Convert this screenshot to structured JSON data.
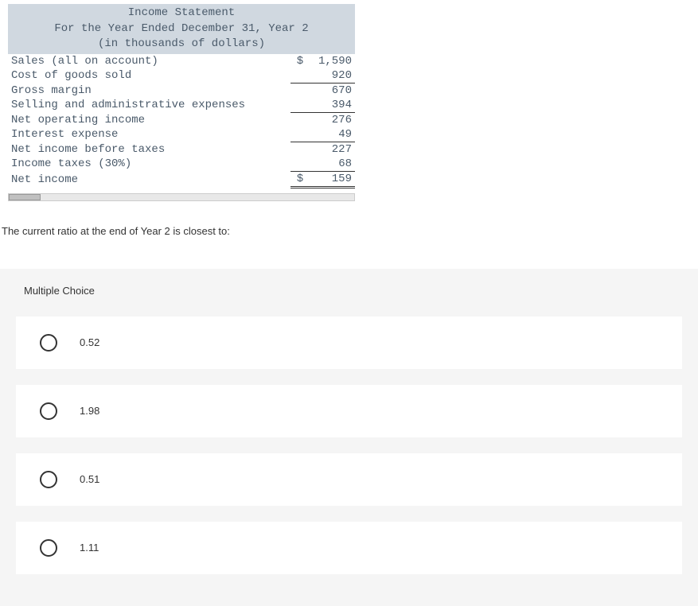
{
  "statement": {
    "title": "Income Statement",
    "subtitle": "For the Year Ended December 31, Year 2",
    "units": "(in thousands of dollars)",
    "rows": [
      {
        "label": "Sales (all on account)",
        "dollar": "$",
        "value": "1,590",
        "underline": ""
      },
      {
        "label": "Cost of goods sold",
        "dollar": "",
        "value": "920",
        "underline": "single"
      },
      {
        "label": "Gross margin",
        "dollar": "",
        "value": "670",
        "underline": ""
      },
      {
        "label": "Selling and administrative expenses",
        "dollar": "",
        "value": "394",
        "underline": "single"
      },
      {
        "label": "Net operating income",
        "dollar": "",
        "value": "276",
        "underline": ""
      },
      {
        "label": "Interest expense",
        "dollar": "",
        "value": "49",
        "underline": "single"
      },
      {
        "label": "Net income before taxes",
        "dollar": "",
        "value": "227",
        "underline": ""
      },
      {
        "label": "Income taxes (30%)",
        "dollar": "",
        "value": "68",
        "underline": "single"
      },
      {
        "label": "Net income",
        "dollar": "$",
        "value": "159",
        "underline": "double"
      }
    ]
  },
  "question": {
    "text": "The current ratio at the end of Year 2 is closest to:"
  },
  "mc": {
    "header": "Multiple Choice",
    "options": [
      {
        "label": "0.52"
      },
      {
        "label": "1.98"
      },
      {
        "label": "0.51"
      },
      {
        "label": "1.11"
      }
    ]
  }
}
